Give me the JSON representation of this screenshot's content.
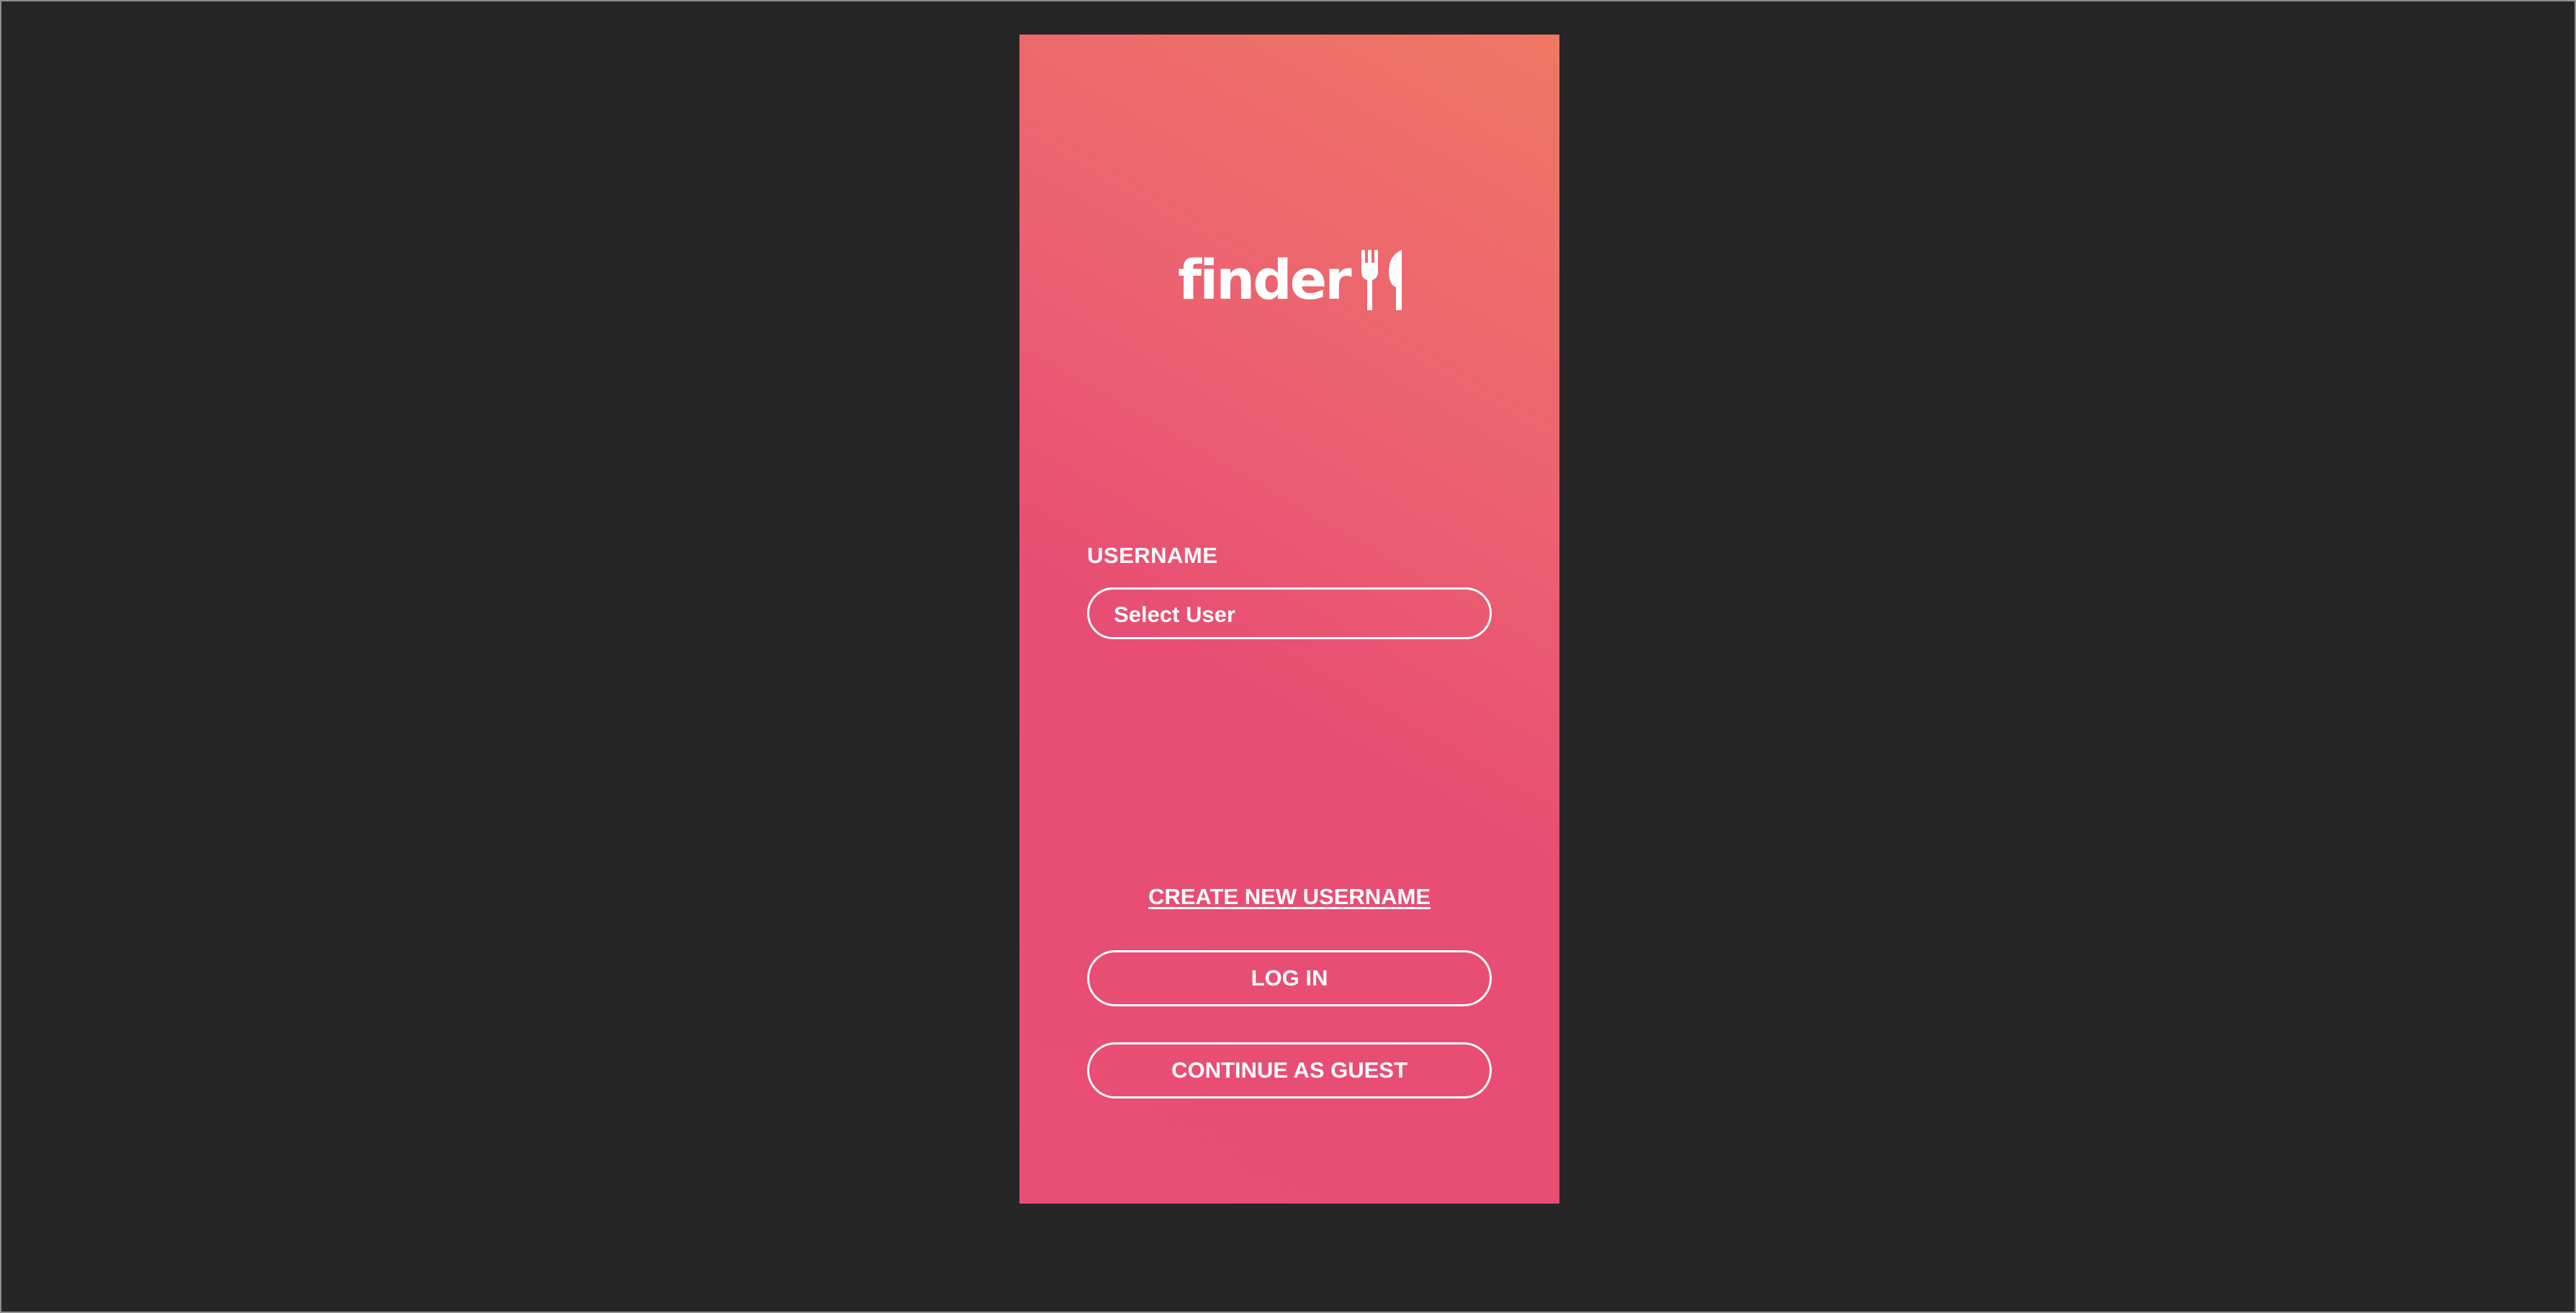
{
  "app": {
    "logo_text": "finder",
    "logo_icon": "fork-knife-icon"
  },
  "login_form": {
    "username_label": "USERNAME",
    "username_select_value": "Select User"
  },
  "actions": {
    "create_username_label": "CREATE NEW USERNAME",
    "login_label": "LOG IN",
    "guest_label": "CONTINUE AS GUEST"
  },
  "colors": {
    "desktop_background": "#262626",
    "gradient_top": "#ef7864",
    "gradient_bottom": "#e84d73",
    "foreground": "#ffffff"
  }
}
